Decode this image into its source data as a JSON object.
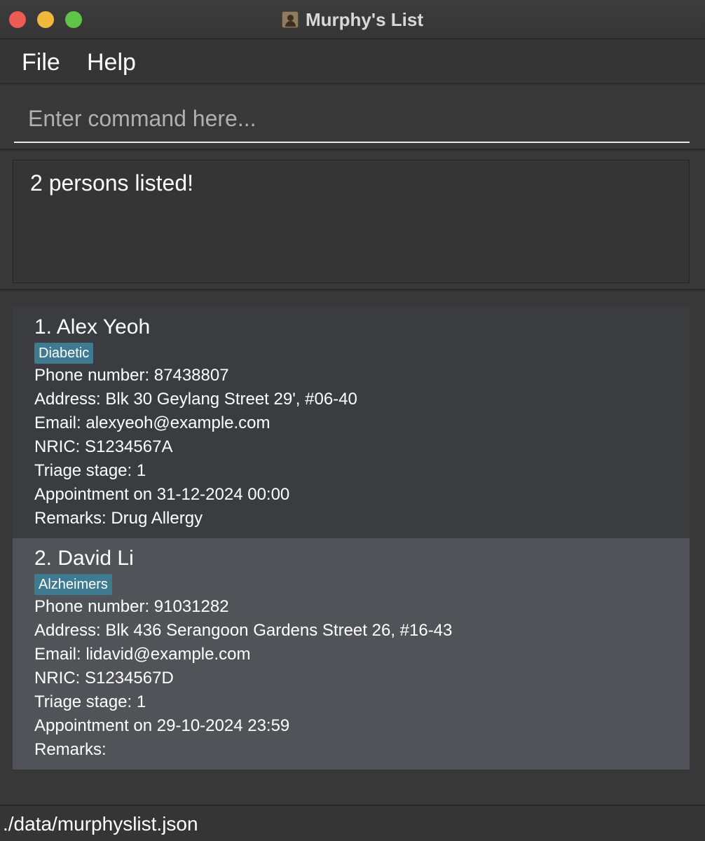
{
  "window": {
    "title": "Murphy's List"
  },
  "menu": {
    "file": "File",
    "help": "Help"
  },
  "command": {
    "placeholder": "Enter command here...",
    "value": ""
  },
  "result": {
    "message": "2 persons listed!"
  },
  "persons": [
    {
      "name": "1. Alex Yeoh",
      "tag": "Diabetic",
      "phone": "Phone number: 87438807",
      "address": "Address: Blk 30 Geylang Street 29', #06-40",
      "email": "Email: alexyeoh@example.com",
      "nric": "NRIC: S1234567A",
      "triage": "Triage stage: 1",
      "appointment": "Appointment on 31-12-2024 00:00",
      "remarks": "Remarks: Drug Allergy"
    },
    {
      "name": "2. David Li",
      "tag": "Alzheimers",
      "phone": "Phone number: 91031282",
      "address": "Address: Blk 436 Serangoon Gardens Street 26, #16-43",
      "email": "Email: lidavid@example.com",
      "nric": "NRIC: S1234567D",
      "triage": "Triage stage: 1",
      "appointment": "Appointment on 29-10-2024 23:59",
      "remarks": "Remarks:"
    }
  ],
  "status": {
    "file_path": "./data/murphyslist.json"
  },
  "colors": {
    "tag_bg": "#3e7b91",
    "selected_card": "#505458",
    "card": "#3b3c3f"
  }
}
